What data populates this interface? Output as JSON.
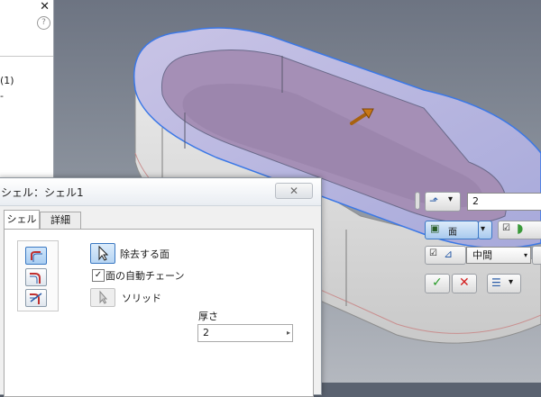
{
  "browser": {
    "close_glyph": "✕",
    "help_glyph": "?",
    "row1": "(1)",
    "row2": "-"
  },
  "dialog": {
    "title": "シェル：シェル1",
    "close_glyph": "✕",
    "tabs": [
      "シェル",
      "詳細"
    ],
    "remove_faces_label": "除去する面",
    "auto_chain_label": "面の自動チェーン",
    "auto_chain_checked": "✓",
    "solid_label": "ソリッド",
    "thickness_label": "厚さ",
    "thickness_value": "2",
    "spinner_glyph": "▸"
  },
  "minitoolbar": {
    "thickness_value": "2",
    "face_label": "面",
    "mode_label": "中間",
    "dropdown_glyph": "▾",
    "ok_glyph": "✓",
    "cancel_glyph": "✕"
  },
  "colors": {
    "accent_blue": "#3b78c6",
    "model_face": "#a98db8",
    "ok_green": "#2a9c2a",
    "cancel_red": "#d22020"
  },
  "icons": [
    "close-icon",
    "help-icon",
    "arrow-select-icon",
    "direction-inside-icon",
    "direction-outside-icon",
    "direction-both-icon",
    "checkbox-icon",
    "ok-check-icon",
    "cancel-x-icon",
    "face-icon",
    "dimension-icon"
  ]
}
